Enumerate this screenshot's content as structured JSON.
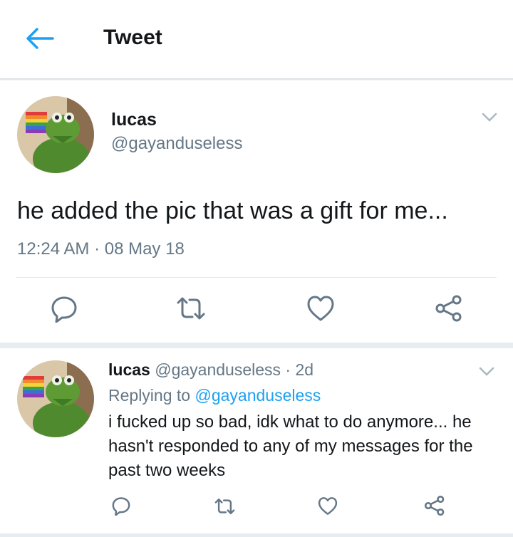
{
  "header": {
    "title": "Tweet",
    "back_icon": "arrow-left-icon",
    "accent": "#1da1f2"
  },
  "main_tweet": {
    "display_name": "lucas",
    "handle": "@gayanduseless",
    "text": "he added the pic that was a gift for me...",
    "timestamp": "12:24 AM · 08 May 18",
    "actions": [
      "reply-icon",
      "retweet-icon",
      "like-icon",
      "share-icon"
    ]
  },
  "reply": {
    "display_name": "lucas",
    "handle_time": "@gayanduseless · 2d",
    "replying_prefix": "Replying to",
    "replying_handle": "@gayanduseless",
    "text_line1": "i fucked up so bad, idk what to do anymore... he",
    "text_line2": "hasn't responded to any of my messages for the",
    "text_line3": "past two weeks",
    "actions": [
      "reply-icon",
      "retweet-icon",
      "like-icon",
      "share-icon"
    ]
  }
}
